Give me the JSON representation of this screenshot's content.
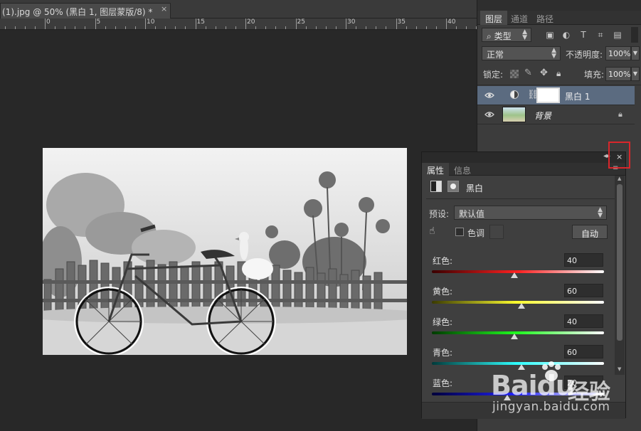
{
  "document": {
    "tab_title": "(1).jpg @ 50% (黑白 1, 图层蒙版/8) *",
    "close_glyph": "×"
  },
  "ruler": {
    "labels": [
      "0",
      "5",
      "10",
      "15",
      "20",
      "25",
      "30",
      "35",
      "40"
    ]
  },
  "layers_panel": {
    "tabs": [
      "图层",
      "通道",
      "路径"
    ],
    "filter": {
      "search_glyph": "⌕",
      "label": "类型"
    },
    "blend_mode": "正常",
    "opacity": {
      "label": "不透明度:",
      "value": "100%"
    },
    "lock_label": "锁定:",
    "fill": {
      "label": "填充:",
      "value": "100%"
    },
    "layers": [
      {
        "name": "黑白 1",
        "selected": true
      },
      {
        "name": "背景",
        "selected": false
      }
    ]
  },
  "properties_panel": {
    "tabs": [
      "属性",
      "信息"
    ],
    "adjustment_name": "黑白",
    "preset": {
      "label": "预设:",
      "value": "默认值"
    },
    "tint_label": "色调",
    "auto_button": "自动",
    "close_glyph": "×",
    "sliders": [
      {
        "label": "红色:",
        "value": "40",
        "gradient": [
          "#3a0000",
          "#ff2020"
        ]
      },
      {
        "label": "黄色:",
        "value": "60",
        "gradient": [
          "#3a3a00",
          "#ffff30"
        ]
      },
      {
        "label": "绿色:",
        "value": "40",
        "gradient": [
          "#003a00",
          "#20ff20"
        ]
      },
      {
        "label": "青色:",
        "value": "60",
        "gradient": [
          "#003a3a",
          "#30ffff"
        ]
      },
      {
        "label": "蓝色:",
        "value": "20",
        "gradient": [
          "#00003a",
          "#2020ff"
        ]
      }
    ]
  },
  "watermark": {
    "brand": "Baidu",
    "product": "经验",
    "url": "jingyan.baidu.com"
  }
}
